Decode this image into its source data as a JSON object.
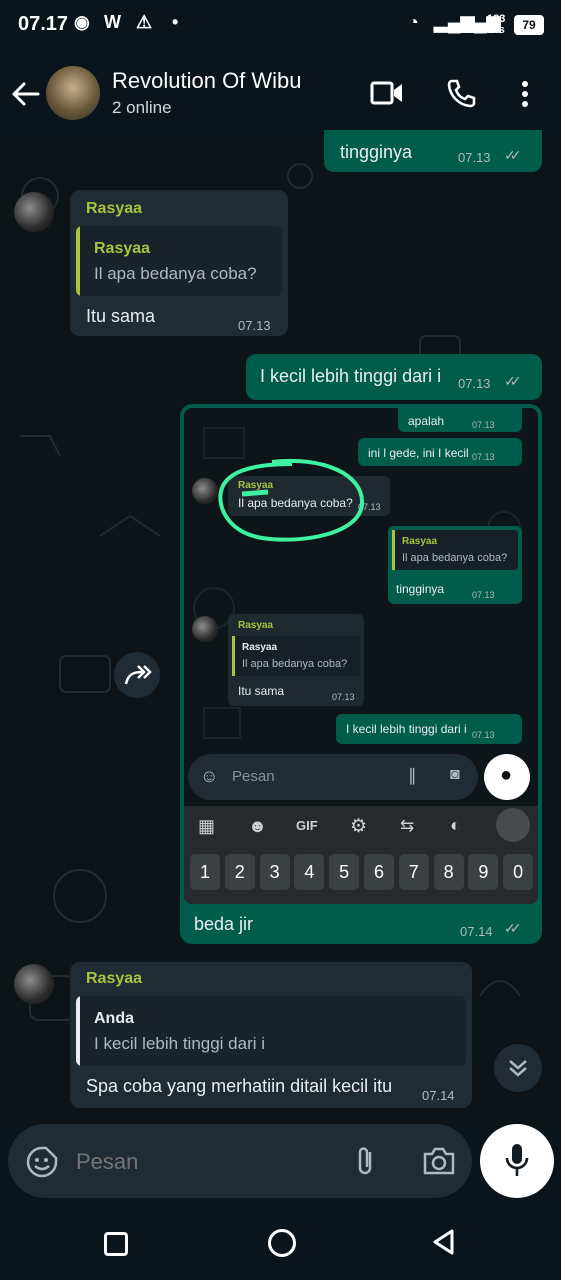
{
  "status_bar": {
    "time": "07.17",
    "net_speed_top": "183",
    "net_speed_bottom": "B/s",
    "battery": "79"
  },
  "header": {
    "title": "Revolution Of Wibu",
    "subtitle": "2 online"
  },
  "messages": {
    "m1": {
      "text": "tingginya",
      "time": "07.13"
    },
    "m2": {
      "sender": "Rasyaa",
      "quote_author": "Rasyaa",
      "quote_text": "Il apa bedanya coba?",
      "text": "Itu sama",
      "time": "07.13"
    },
    "m3": {
      "text": "I kecil lebih tinggi dari i",
      "time": "07.13"
    },
    "m4": {
      "text": "beda jir",
      "time": "07.14"
    },
    "m5": {
      "sender": "Rasyaa",
      "quote_author": "Anda",
      "quote_text": "I kecil lebih tinggi dari i",
      "text": "Spa coba yang merhatiin ditail kecil itu",
      "time": "07.14"
    }
  },
  "screenshot": {
    "b1": {
      "text": "apalah",
      "time": "07.13"
    },
    "b2": {
      "text": "ini l gede, ini I kecil",
      "time": "07.13"
    },
    "b3": {
      "sender": "Rasyaa",
      "text": "Il apa bedanya coba?",
      "time": "07.13"
    },
    "b4": {
      "quote_author": "Rasyaa",
      "quote_text": "Il apa bedanya coba?",
      "text": "tingginya",
      "time": "07.13"
    },
    "b5": {
      "sender": "Rasyaa",
      "quote_author": "Rasyaa",
      "quote_text": "Il apa bedanya coba?",
      "text": "Itu sama",
      "time": "07.13"
    },
    "b6": {
      "text": "I kecil lebih tinggi dari i",
      "time": "07.13"
    },
    "input_placeholder": "Pesan",
    "gif_label": "GIF",
    "keys": [
      "1",
      "2",
      "3",
      "4",
      "5",
      "6",
      "7",
      "8",
      "9",
      "0"
    ]
  },
  "input": {
    "placeholder": "Pesan"
  },
  "colors": {
    "outgoing": "#005c4b",
    "incoming": "#202c33",
    "sender_name": "#a9c23f",
    "background": "#0b141a"
  }
}
